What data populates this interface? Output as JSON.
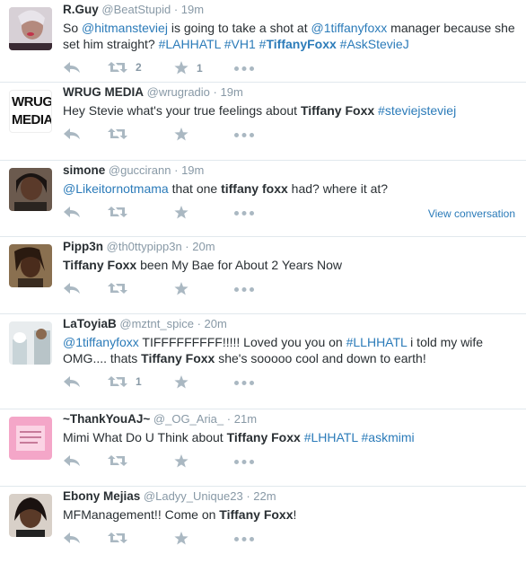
{
  "tweets": [
    {
      "fullname": "R.Guy",
      "username": "@BeatStupid",
      "time": "19m",
      "segments": [
        {
          "t": "So ",
          "k": "plain"
        },
        {
          "t": "@hitmansteviej",
          "k": "link"
        },
        {
          "t": " is going to take a shot at ",
          "k": "plain"
        },
        {
          "t": "@1tiffanyfoxx",
          "k": "link"
        },
        {
          "t": " manager because she set him straight? ",
          "k": "plain"
        },
        {
          "t": "#LAHHATL",
          "k": "link"
        },
        {
          "t": " ",
          "k": "plain"
        },
        {
          "t": "#VH1",
          "k": "link"
        },
        {
          "t": " ",
          "k": "plain"
        },
        {
          "t": "#",
          "k": "link"
        },
        {
          "t": "TiffanyFoxx",
          "k": "linkbold"
        },
        {
          "t": " ",
          "k": "plain"
        },
        {
          "t": "#AskStevieJ",
          "k": "link"
        }
      ],
      "retweets": "2",
      "favorites": "1",
      "view_conversation": ""
    },
    {
      "fullname": "WRUG MEDIA",
      "username": "@wrugradio",
      "time": "19m",
      "avatar_text": "WRUG MEDIA",
      "segments": [
        {
          "t": "Hey Stevie what's your true feelings about ",
          "k": "plain"
        },
        {
          "t": "Tiffany Foxx",
          "k": "bold"
        },
        {
          "t": " ",
          "k": "plain"
        },
        {
          "t": "#steviejsteviej",
          "k": "link"
        }
      ],
      "retweets": "",
      "favorites": "",
      "view_conversation": ""
    },
    {
      "fullname": "simone",
      "username": "@guccirann",
      "time": "19m",
      "segments": [
        {
          "t": "@Likeitornotmama",
          "k": "link"
        },
        {
          "t": " that one ",
          "k": "plain"
        },
        {
          "t": "tiffany foxx",
          "k": "bold"
        },
        {
          "t": " had? where it at?",
          "k": "plain"
        }
      ],
      "retweets": "",
      "favorites": "",
      "view_conversation": "View conversation"
    },
    {
      "fullname": "Pipp3n",
      "username": "@th0ttypipp3n",
      "time": "20m",
      "segments": [
        {
          "t": "Tiffany Foxx",
          "k": "bold"
        },
        {
          "t": " been My Bae for About 2 Years Now",
          "k": "plain"
        }
      ],
      "retweets": "",
      "favorites": "",
      "view_conversation": ""
    },
    {
      "fullname": "LaToyiaB",
      "username": "@mztnt_spice",
      "time": "20m",
      "segments": [
        {
          "t": "@1tiffanyfoxx",
          "k": "link"
        },
        {
          "t": " TIFFFFFFFFF!!!!! Loved you you on ",
          "k": "plain"
        },
        {
          "t": "#LLHHATL",
          "k": "link"
        },
        {
          "t": " i told my wife OMG.... thats ",
          "k": "plain"
        },
        {
          "t": "Tiffany Foxx",
          "k": "bold"
        },
        {
          "t": " she's sooooo cool and down to earth!",
          "k": "plain"
        }
      ],
      "retweets": "1",
      "favorites": "",
      "view_conversation": ""
    },
    {
      "fullname": "~ThankYouAJ~",
      "username": "@_OG_Aria_",
      "time": "21m",
      "segments": [
        {
          "t": "Mimi What Do U Think about ",
          "k": "plain"
        },
        {
          "t": "Tiffany Foxx",
          "k": "bold"
        },
        {
          "t": " ",
          "k": "plain"
        },
        {
          "t": "#LHHATL",
          "k": "link"
        },
        {
          "t": " ",
          "k": "plain"
        },
        {
          "t": "#askmimi",
          "k": "link"
        }
      ],
      "retweets": "",
      "favorites": "",
      "view_conversation": ""
    },
    {
      "fullname": "Ebony Mejias",
      "username": "@Ladyy_Unique23",
      "time": "22m",
      "segments": [
        {
          "t": "MFManagement!! Come on ",
          "k": "plain"
        },
        {
          "t": "Tiffany Foxx",
          "k": "bold"
        },
        {
          "t": "!",
          "k": "plain"
        }
      ],
      "retweets": "",
      "favorites": "",
      "view_conversation": ""
    }
  ],
  "separator_dot": "·",
  "colors": {
    "link": "#2b7bb9",
    "meta": "#8899a6",
    "action_icon": "#aab8c2",
    "divider": "#e1e8ed"
  },
  "icons": {
    "reply": "reply-icon",
    "retweet": "retweet-icon",
    "favorite": "star-icon",
    "more": "more-icon"
  }
}
